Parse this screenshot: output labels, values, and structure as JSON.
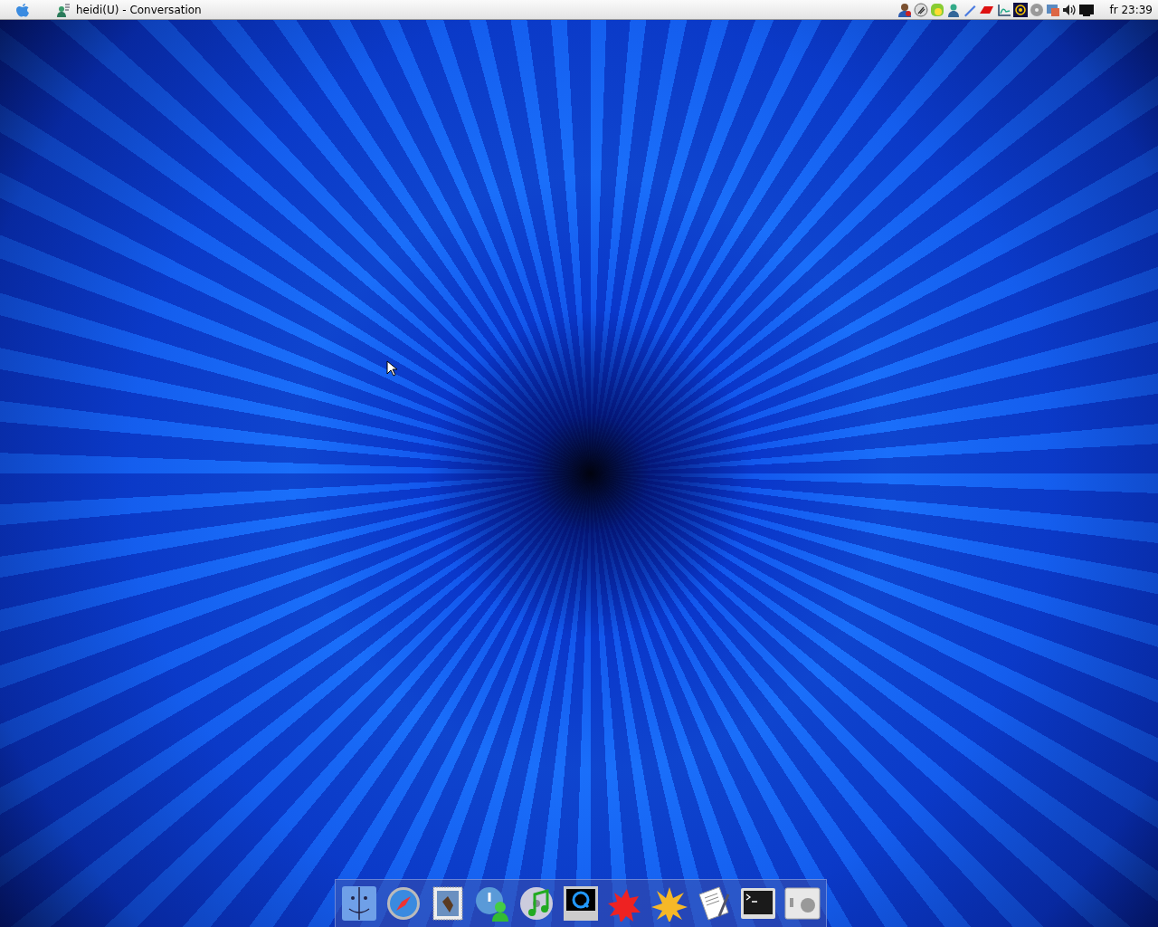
{
  "menu_bar": {
    "app_title": "heidi(U) - Conversation",
    "clock": "fr 23:39"
  }
}
